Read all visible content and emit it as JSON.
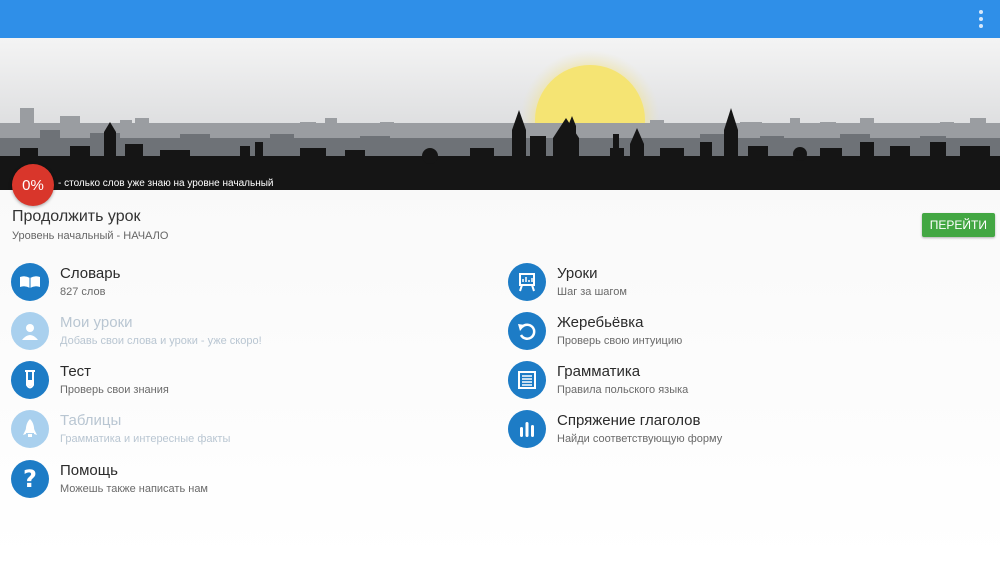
{
  "appbar": {
    "bg": "#2f8fe8",
    "menu_icon": "more-vertical-icon"
  },
  "banner": {
    "progress": "0%",
    "caption": "- столько слов уже знаю на уровне начальный"
  },
  "continue_lesson": {
    "title": "Продолжить урок",
    "subtitle": "Уровень начальный - НАЧАЛО",
    "go_label": "ПЕРЕЙТИ"
  },
  "menu_left": [
    {
      "title": "Словарь",
      "subtitle": "827 слов",
      "icon": "open-book-icon",
      "enabled": true
    },
    {
      "title": "Мои уроки",
      "subtitle": "Добавь свои слова и уроки - уже скоро!",
      "icon": "user-icon",
      "enabled": false
    },
    {
      "title": "Тест",
      "subtitle": "Проверь свои знания",
      "icon": "test-tube-icon",
      "enabled": true
    },
    {
      "title": "Таблицы",
      "subtitle": "Грамматика и интересные факты",
      "icon": "rocket-icon",
      "enabled": false
    },
    {
      "title": "Помощь",
      "subtitle": "Можешь также написать нам",
      "icon": "question-icon",
      "enabled": true
    }
  ],
  "menu_right": [
    {
      "title": "Уроки",
      "subtitle": "Шаг за шагом",
      "icon": "presentation-board-icon",
      "enabled": true
    },
    {
      "title": "Жеребьёвка",
      "subtitle": "Проверь свою интуицию",
      "icon": "undo-icon",
      "enabled": true
    },
    {
      "title": "Грамматика",
      "subtitle": "Правила польского языка",
      "icon": "grammar-book-icon",
      "enabled": true
    },
    {
      "title": "Спряжение глаголов",
      "subtitle": "Найди соответствующую форму",
      "icon": "bars-icon",
      "enabled": true
    }
  ],
  "colors": {
    "accent": "#1d7cc6",
    "badge": "#d9362b",
    "go_button": "#43a743"
  }
}
